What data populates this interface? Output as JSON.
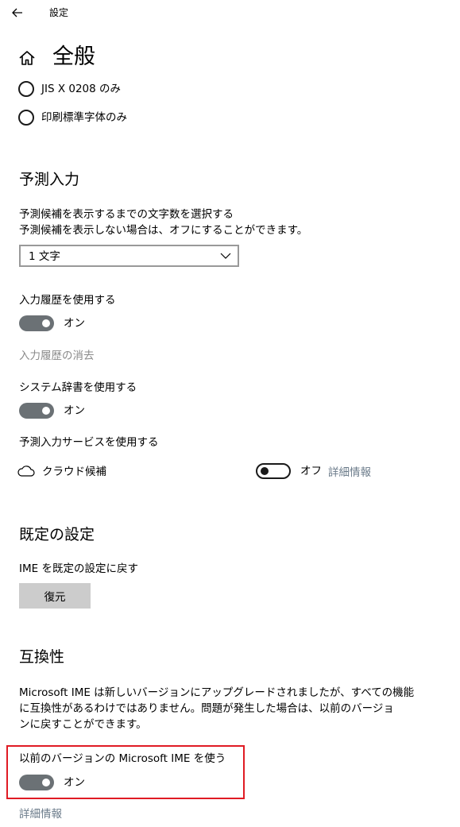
{
  "window": {
    "title": "設定"
  },
  "page": {
    "title": "全般"
  },
  "charset_options": [
    {
      "label": "JIS X 0208 のみ",
      "selected": false
    },
    {
      "label": "印刷標準字体のみ",
      "selected": false
    }
  ],
  "predictive": {
    "heading": "予測入力",
    "description_line1": "予測候補を表示するまでの文字数を選択する",
    "description_line2": "予測候補を表示しない場合は、オフにすることができます。",
    "char_count_selected": "1 文字",
    "history_label": "入力履歴を使用する",
    "history_state": "オン",
    "clear_history_link": "入力履歴の消去",
    "system_dict_label": "システム辞書を使用する",
    "system_dict_state": "オン",
    "service_label": "予測入力サービスを使用する",
    "cloud_label": "クラウド候補",
    "cloud_state": "オフ",
    "cloud_details_link": "詳細情報"
  },
  "defaults": {
    "heading": "既定の設定",
    "reset_label": "IME を既定の設定に戻す",
    "reset_button": "復元"
  },
  "compat": {
    "heading": "互換性",
    "para_line1": "Microsoft IME は新しいバージョンにアップグレードされましたが、すべての機能",
    "para_line2": "に互換性があるわけではありません。問題が発生した場合は、以前のバージョ",
    "para_line3": "ンに戻すことができます。",
    "prev_version_label": "以前のバージョンの Microsoft IME を使う",
    "prev_version_state": "オン",
    "details_link": "詳細情報"
  },
  "colors": {
    "toggle_on": "#6b7175",
    "link": "#6b7b8a",
    "highlight": "#e01b24",
    "button_bg": "#cccccc"
  },
  "icons": {
    "back": "back-arrow-icon",
    "home": "home-icon",
    "chevron": "chevron-down-icon",
    "cloud": "cloud-icon"
  }
}
